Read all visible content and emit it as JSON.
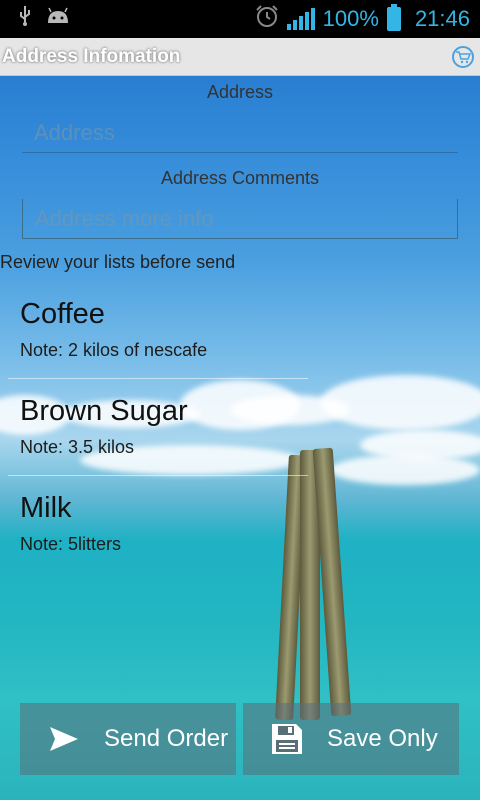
{
  "status_bar": {
    "battery_percent": "100%",
    "time": "21:46",
    "icons": [
      "usb-icon",
      "android-icon",
      "alarm-icon",
      "signal-icon",
      "battery-icon"
    ]
  },
  "title_bar": {
    "title": "Address Infomation",
    "icon": "cart-icon"
  },
  "form": {
    "address_label": "Address",
    "address_placeholder": "Address",
    "comments_label": "Address Comments",
    "comments_placeholder": "Address more info"
  },
  "review_label": "Review your lists before send",
  "items": [
    {
      "name": "Coffee",
      "note": "Note: 2 kilos of nescafe"
    },
    {
      "name": "Brown Sugar",
      "note": "Note: 3.5 kilos"
    },
    {
      "name": "Milk",
      "note": "Note: 5litters"
    }
  ],
  "buttons": {
    "send_label": "Send Order",
    "save_label": "Save Only"
  },
  "colors": {
    "status_accent": "#33b5e5",
    "button_bg": "rgba(90,110,120,0.55)"
  }
}
